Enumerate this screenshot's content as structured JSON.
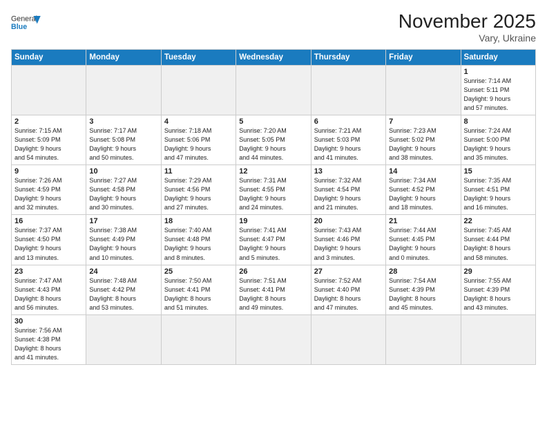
{
  "header": {
    "logo_text_general": "General",
    "logo_text_blue": "Blue",
    "month_year": "November 2025",
    "location": "Vary, Ukraine"
  },
  "weekdays": [
    "Sunday",
    "Monday",
    "Tuesday",
    "Wednesday",
    "Thursday",
    "Friday",
    "Saturday"
  ],
  "weeks": [
    [
      {
        "day": "",
        "info": "",
        "empty": true
      },
      {
        "day": "",
        "info": "",
        "empty": true
      },
      {
        "day": "",
        "info": "",
        "empty": true
      },
      {
        "day": "",
        "info": "",
        "empty": true
      },
      {
        "day": "",
        "info": "",
        "empty": true
      },
      {
        "day": "",
        "info": "",
        "empty": true
      },
      {
        "day": "1",
        "info": "Sunrise: 7:14 AM\nSunset: 5:11 PM\nDaylight: 9 hours\nand 57 minutes."
      }
    ],
    [
      {
        "day": "2",
        "info": "Sunrise: 7:15 AM\nSunset: 5:09 PM\nDaylight: 9 hours\nand 54 minutes."
      },
      {
        "day": "3",
        "info": "Sunrise: 7:17 AM\nSunset: 5:08 PM\nDaylight: 9 hours\nand 50 minutes."
      },
      {
        "day": "4",
        "info": "Sunrise: 7:18 AM\nSunset: 5:06 PM\nDaylight: 9 hours\nand 47 minutes."
      },
      {
        "day": "5",
        "info": "Sunrise: 7:20 AM\nSunset: 5:05 PM\nDaylight: 9 hours\nand 44 minutes."
      },
      {
        "day": "6",
        "info": "Sunrise: 7:21 AM\nSunset: 5:03 PM\nDaylight: 9 hours\nand 41 minutes."
      },
      {
        "day": "7",
        "info": "Sunrise: 7:23 AM\nSunset: 5:02 PM\nDaylight: 9 hours\nand 38 minutes."
      },
      {
        "day": "8",
        "info": "Sunrise: 7:24 AM\nSunset: 5:00 PM\nDaylight: 9 hours\nand 35 minutes."
      }
    ],
    [
      {
        "day": "9",
        "info": "Sunrise: 7:26 AM\nSunset: 4:59 PM\nDaylight: 9 hours\nand 32 minutes."
      },
      {
        "day": "10",
        "info": "Sunrise: 7:27 AM\nSunset: 4:58 PM\nDaylight: 9 hours\nand 30 minutes."
      },
      {
        "day": "11",
        "info": "Sunrise: 7:29 AM\nSunset: 4:56 PM\nDaylight: 9 hours\nand 27 minutes."
      },
      {
        "day": "12",
        "info": "Sunrise: 7:31 AM\nSunset: 4:55 PM\nDaylight: 9 hours\nand 24 minutes."
      },
      {
        "day": "13",
        "info": "Sunrise: 7:32 AM\nSunset: 4:54 PM\nDaylight: 9 hours\nand 21 minutes."
      },
      {
        "day": "14",
        "info": "Sunrise: 7:34 AM\nSunset: 4:52 PM\nDaylight: 9 hours\nand 18 minutes."
      },
      {
        "day": "15",
        "info": "Sunrise: 7:35 AM\nSunset: 4:51 PM\nDaylight: 9 hours\nand 16 minutes."
      }
    ],
    [
      {
        "day": "16",
        "info": "Sunrise: 7:37 AM\nSunset: 4:50 PM\nDaylight: 9 hours\nand 13 minutes."
      },
      {
        "day": "17",
        "info": "Sunrise: 7:38 AM\nSunset: 4:49 PM\nDaylight: 9 hours\nand 10 minutes."
      },
      {
        "day": "18",
        "info": "Sunrise: 7:40 AM\nSunset: 4:48 PM\nDaylight: 9 hours\nand 8 minutes."
      },
      {
        "day": "19",
        "info": "Sunrise: 7:41 AM\nSunset: 4:47 PM\nDaylight: 9 hours\nand 5 minutes."
      },
      {
        "day": "20",
        "info": "Sunrise: 7:43 AM\nSunset: 4:46 PM\nDaylight: 9 hours\nand 3 minutes."
      },
      {
        "day": "21",
        "info": "Sunrise: 7:44 AM\nSunset: 4:45 PM\nDaylight: 9 hours\nand 0 minutes."
      },
      {
        "day": "22",
        "info": "Sunrise: 7:45 AM\nSunset: 4:44 PM\nDaylight: 8 hours\nand 58 minutes."
      }
    ],
    [
      {
        "day": "23",
        "info": "Sunrise: 7:47 AM\nSunset: 4:43 PM\nDaylight: 8 hours\nand 56 minutes."
      },
      {
        "day": "24",
        "info": "Sunrise: 7:48 AM\nSunset: 4:42 PM\nDaylight: 8 hours\nand 53 minutes."
      },
      {
        "day": "25",
        "info": "Sunrise: 7:50 AM\nSunset: 4:41 PM\nDaylight: 8 hours\nand 51 minutes."
      },
      {
        "day": "26",
        "info": "Sunrise: 7:51 AM\nSunset: 4:41 PM\nDaylight: 8 hours\nand 49 minutes."
      },
      {
        "day": "27",
        "info": "Sunrise: 7:52 AM\nSunset: 4:40 PM\nDaylight: 8 hours\nand 47 minutes."
      },
      {
        "day": "28",
        "info": "Sunrise: 7:54 AM\nSunset: 4:39 PM\nDaylight: 8 hours\nand 45 minutes."
      },
      {
        "day": "29",
        "info": "Sunrise: 7:55 AM\nSunset: 4:39 PM\nDaylight: 8 hours\nand 43 minutes."
      }
    ],
    [
      {
        "day": "30",
        "info": "Sunrise: 7:56 AM\nSunset: 4:38 PM\nDaylight: 8 hours\nand 41 minutes.",
        "last": true
      },
      {
        "day": "",
        "info": "",
        "empty": true,
        "last": true
      },
      {
        "day": "",
        "info": "",
        "empty": true,
        "last": true
      },
      {
        "day": "",
        "info": "",
        "empty": true,
        "last": true
      },
      {
        "day": "",
        "info": "",
        "empty": true,
        "last": true
      },
      {
        "day": "",
        "info": "",
        "empty": true,
        "last": true
      },
      {
        "day": "",
        "info": "",
        "empty": true,
        "last": true
      }
    ]
  ]
}
